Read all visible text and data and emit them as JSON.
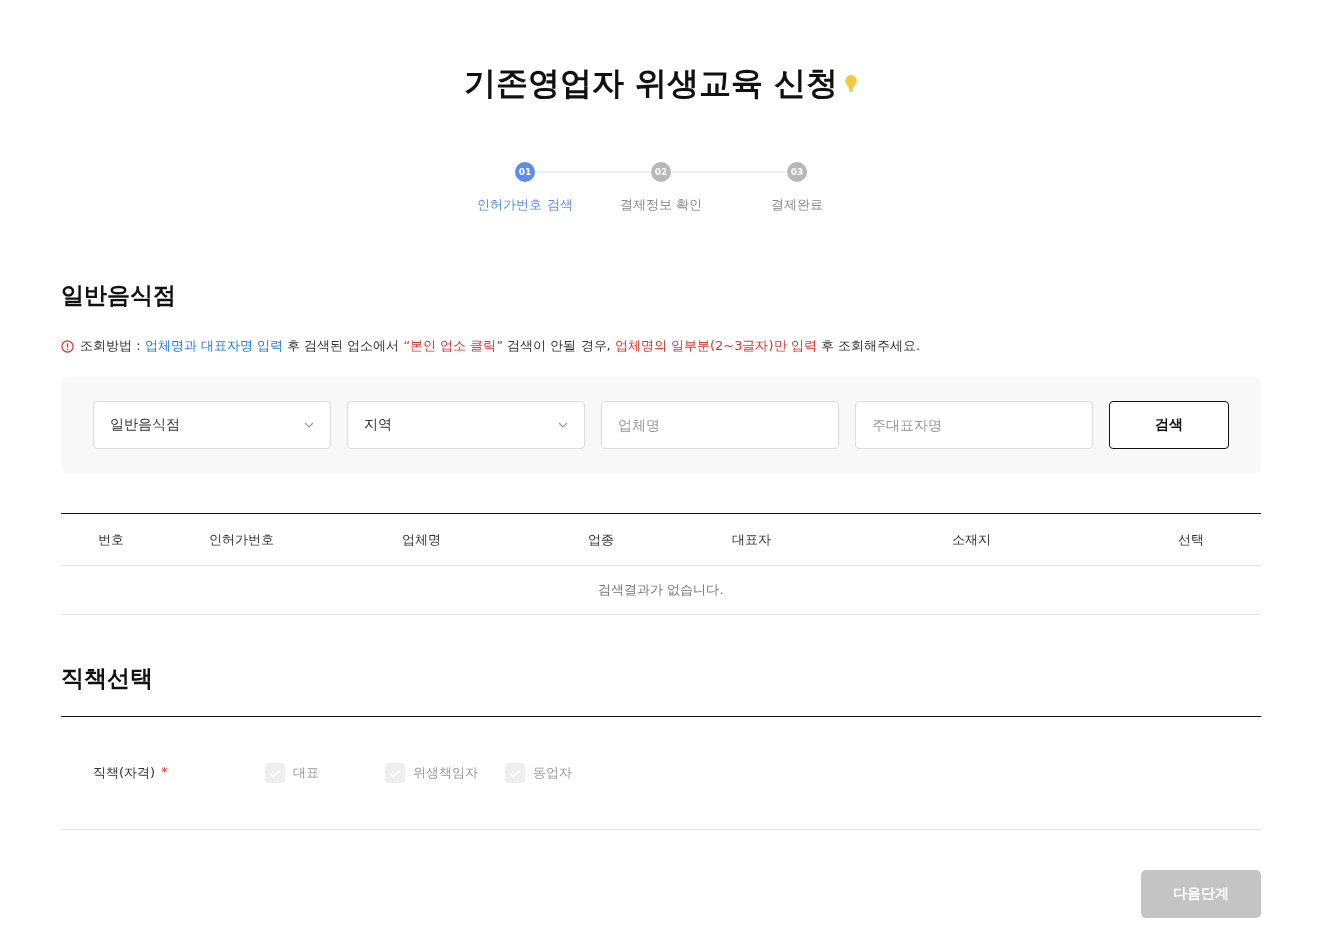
{
  "title": "기존영업자 위생교육 신청",
  "steps": [
    {
      "number": "01",
      "label": "인허가번호 검색",
      "selected": true
    },
    {
      "number": "02",
      "label": "결제정보 확인",
      "selected": false
    },
    {
      "number": "03",
      "label": "결제완료",
      "selected": false
    }
  ],
  "search_section": {
    "heading": "일반음식점",
    "notice": [
      {
        "kind": "plain",
        "text": "조회방법 : "
      },
      {
        "kind": "blue",
        "text": "업체명과 대표자명 입력"
      },
      {
        "kind": "plain",
        "text": " 후 검색된 업소에서 "
      },
      {
        "kind": "red",
        "text": "“본인 업소 클릭”"
      },
      {
        "kind": "plain",
        "text": " 검색이 안될 경우, "
      },
      {
        "kind": "red",
        "text": "업체명의 일부분(2~3글자)만 입력"
      },
      {
        "kind": "plain",
        "text": " 후 조회해주세요."
      }
    ],
    "filters": [
      {
        "kind": "select",
        "value": "일반음식점"
      },
      {
        "kind": "select",
        "value": "지역"
      },
      {
        "kind": "input",
        "placeholder": "업체명"
      },
      {
        "kind": "input",
        "placeholder": "주대표자명"
      }
    ],
    "search_button": "검색"
  },
  "table": {
    "columns": [
      "번호",
      "인허가번호",
      "업체명",
      "업종",
      "대표자",
      "소재지",
      "선택"
    ],
    "empty_message": "검색결과가 없습니다."
  },
  "role_section": {
    "heading": "직책선택",
    "label": "직책(자격)",
    "required_mark": "*",
    "options": [
      {
        "label": "대표",
        "checked": false
      },
      {
        "label": "위생책임자",
        "checked": false
      },
      {
        "label": "동업자",
        "checked": false
      }
    ]
  },
  "next_button": {
    "label": "다음단계",
    "disabled": true
  }
}
